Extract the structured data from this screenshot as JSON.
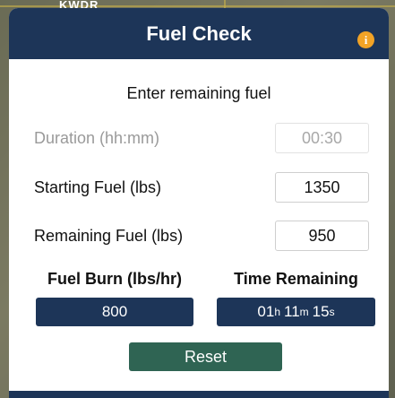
{
  "map": {
    "label": "KWDR"
  },
  "header": {
    "title": "Fuel Check",
    "info_icon_glyph": "i"
  },
  "subtitle": "Enter remaining fuel",
  "fields": {
    "duration": {
      "label": "Duration (hh:mm)",
      "value": "00:30"
    },
    "starting_fuel": {
      "label": "Starting Fuel (lbs)",
      "value": "1350"
    },
    "remaining_fuel": {
      "label": "Remaining Fuel (lbs)",
      "value": "950"
    }
  },
  "results": {
    "fuel_burn": {
      "label": "Fuel Burn (lbs/hr)",
      "value": "800"
    },
    "time_remaining": {
      "label": "Time Remaining",
      "hours": "01",
      "hours_unit": "h",
      "minutes": "11",
      "minutes_unit": "m",
      "seconds": "15",
      "seconds_unit": "s"
    }
  },
  "reset_label": "Reset",
  "colors": {
    "header": "#1d3558",
    "info": "#f2a326",
    "reset": "#2f6453"
  }
}
